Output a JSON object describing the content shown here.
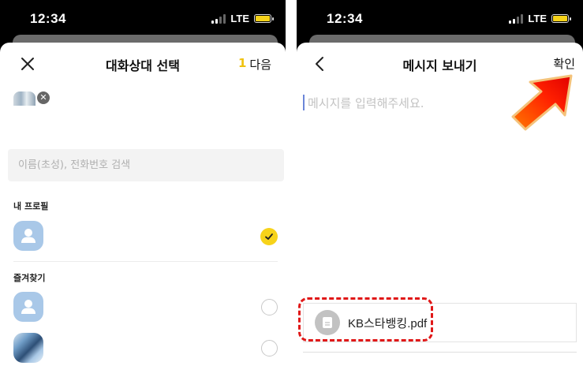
{
  "status_bar": {
    "time": "12:34",
    "network": "LTE"
  },
  "left_screen": {
    "close_icon": "close-icon",
    "title": "대화상대 선택",
    "next": {
      "count": "1",
      "label": "다음"
    },
    "search": {
      "placeholder": "이름(초성), 전화번호 검색"
    },
    "sections": {
      "my_profile": "내 프로필",
      "favorites": "즐겨찾기"
    },
    "contacts": [
      {
        "section": "my_profile",
        "avatar": "default-profile",
        "checked": true
      },
      {
        "section": "favorites",
        "avatar": "default-profile",
        "checked": false
      },
      {
        "section": "favorites",
        "avatar": "photo",
        "checked": false
      }
    ]
  },
  "right_screen": {
    "back_icon": "chevron-left-icon",
    "title": "메시지 보내기",
    "confirm_label": "확인",
    "message_input": {
      "placeholder": "메시지를 입력해주세요.",
      "value": ""
    },
    "attachment": {
      "icon": "document-icon",
      "file_name": "KB스타뱅킹.pdf"
    }
  },
  "colors": {
    "accent_yellow": "#f7d31a",
    "annotation_red": "#e01818",
    "avatar_blue": "#a9c8e8"
  }
}
